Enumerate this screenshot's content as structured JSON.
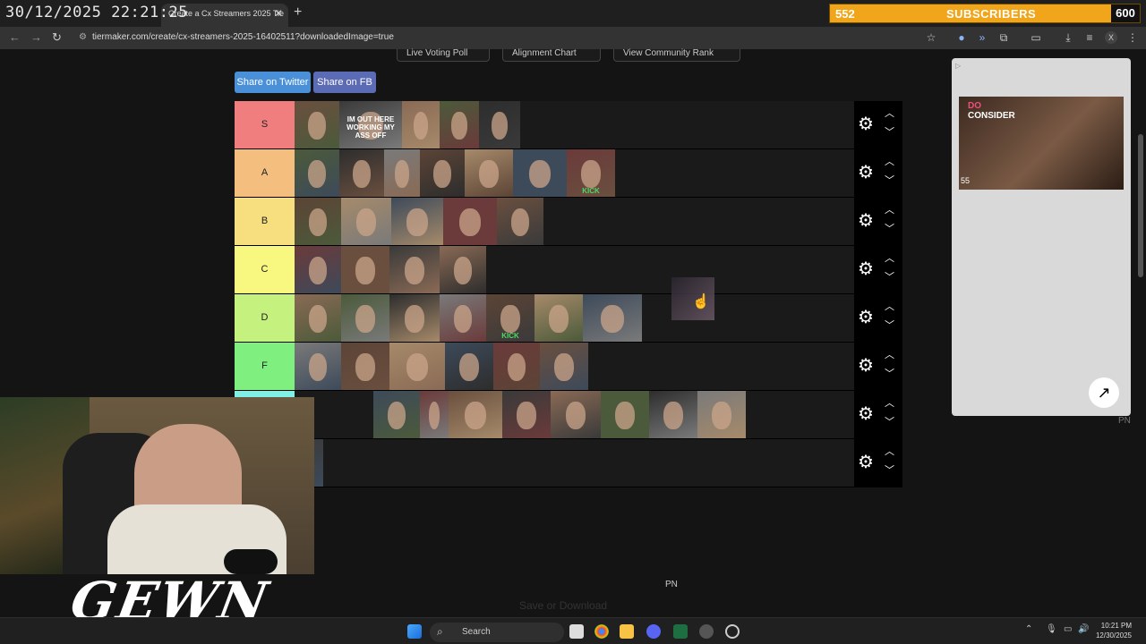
{
  "overlay": {
    "timestamp": "30/12/2025 22:21:25",
    "watermark_right": "PN",
    "watermark_bottom": "PN",
    "logo_text": "GEWN"
  },
  "subscriber_goal": {
    "current": "552",
    "label": "SUBSCRIBERS",
    "goal": "600",
    "bar_color": "#f1a51a",
    "progress": 0.92
  },
  "browser": {
    "tab_title": "Create a Cx Streamers 2025 Tie",
    "url": "tiermaker.com/create/cx-streamers-2025-16402511?downloadedImage=true"
  },
  "page": {
    "top_links": [
      "Live Voting Poll",
      "Alignment Chart",
      "View Community Rank"
    ],
    "share_twitter": "Share on Twitter",
    "share_fb": "Share on FB",
    "save_button": "Save or Download"
  },
  "tiers": [
    {
      "label": "S",
      "color": "#f17e7e",
      "item_count": 5
    },
    {
      "label": "A",
      "color": "#f4be7f",
      "item_count": 7
    },
    {
      "label": "B",
      "color": "#f7df80",
      "item_count": 5
    },
    {
      "label": "C",
      "color": "#f8f780",
      "item_count": 4
    },
    {
      "label": "D",
      "color": "#c5f27e",
      "item_count": 7
    },
    {
      "label": "F",
      "color": "#7ff07f",
      "item_count": 6
    },
    {
      "label": "",
      "color": "#7ff0e6",
      "item_count": 8
    },
    {
      "label": "",
      "color": "#7fbff0",
      "item_count": 1
    }
  ],
  "thumb_captions": {
    "s_2": "IM OUT HERE WORKING MY ASS OFF",
    "a_7": "KICK",
    "d_5": "KICK"
  },
  "ad": {
    "headline_small": "DO",
    "headline": "CONSIDER",
    "badge": "55"
  },
  "taskbar": {
    "search_placeholder": "Search",
    "time": "10:21 PM",
    "date": "12/30/2025"
  }
}
